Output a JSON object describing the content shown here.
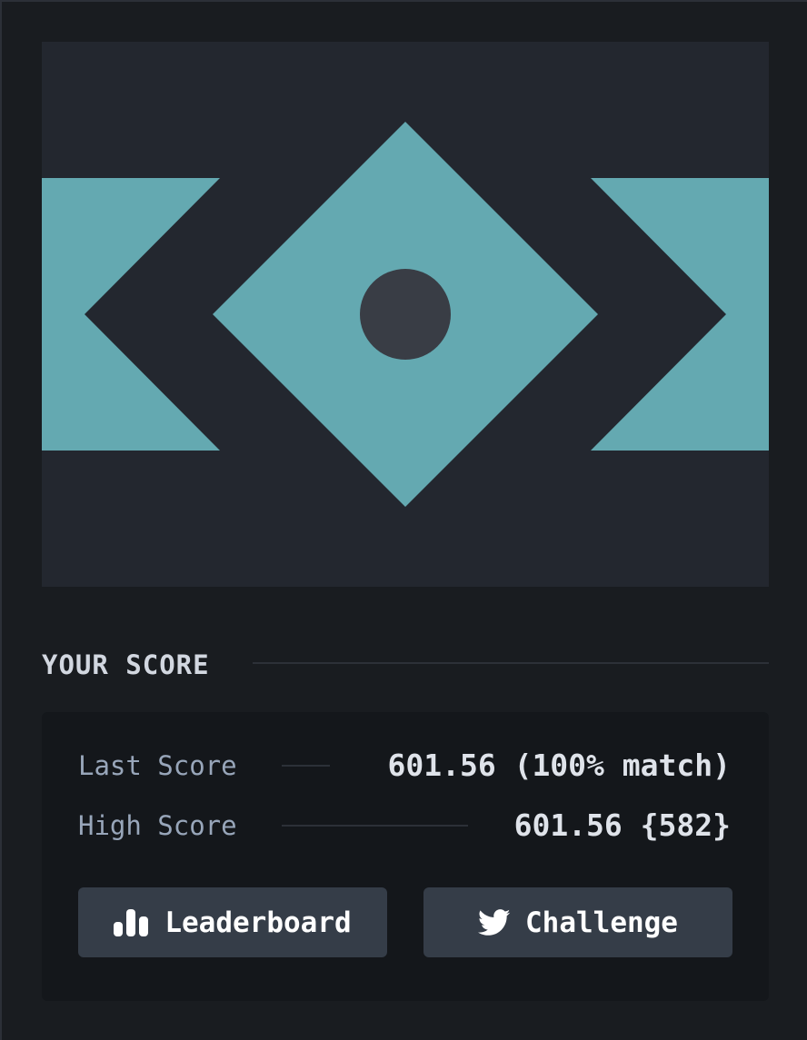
{
  "colors": {
    "background": "#191c20",
    "canvas": "#23272f",
    "shape": "#64a9b1",
    "center_dot": "#393d45",
    "card": "#14171b",
    "button": "#353d48",
    "label": "#98a6ba",
    "value": "#dfe3ea"
  },
  "section": {
    "title": "YOUR SCORE"
  },
  "scores": {
    "last_label": "Last Score",
    "last_value": "601.56 (100% match)",
    "high_label": "High Score",
    "high_value": "601.56 {582}"
  },
  "buttons": {
    "leaderboard": {
      "label": "Leaderboard",
      "icon": "bar-chart-icon"
    },
    "challenge": {
      "label": "Challenge",
      "icon": "twitter-bird-icon"
    }
  }
}
